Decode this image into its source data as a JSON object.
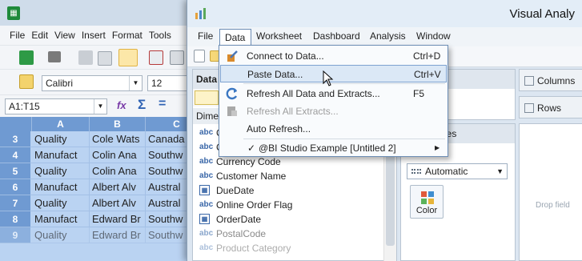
{
  "sheet": {
    "menu": [
      "File",
      "Edit",
      "View",
      "Insert",
      "Format",
      "Tools"
    ],
    "font": "Calibri",
    "font_size": "12",
    "name_box": "A1:T15",
    "columns": [
      "A",
      "B",
      "C"
    ],
    "rows": [
      {
        "num": "3",
        "a": "Quality",
        "b": "Cole Wats",
        "c": "Canada"
      },
      {
        "num": "4",
        "a": "Manufact",
        "b": "Colin Ana",
        "c": "Southw"
      },
      {
        "num": "5",
        "a": "Quality",
        "b": "Colin Ana",
        "c": "Southw"
      },
      {
        "num": "6",
        "a": "Manufact",
        "b": "Albert Alv",
        "c": "Austral"
      },
      {
        "num": "7",
        "a": "Quality",
        "b": "Albert Alv",
        "c": "Austral"
      },
      {
        "num": "8",
        "a": "Manufact",
        "b": "Edward Br",
        "c": "Southw"
      },
      {
        "num": "9",
        "a": "Quality",
        "b": "Edward Br",
        "c": "Southw"
      }
    ]
  },
  "va": {
    "title": "Visual Analy",
    "menu": [
      "File",
      "Data",
      "Worksheet",
      "Dashboard",
      "Analysis",
      "Window"
    ],
    "data_pane_title": "Data",
    "dimensions_label": "Dimens",
    "fields": [
      {
        "icon": "abc",
        "name": "C"
      },
      {
        "icon": "abc",
        "name": "C"
      },
      {
        "icon": "abc",
        "name": "Currency Code"
      },
      {
        "icon": "abc",
        "name": "Customer Name"
      },
      {
        "icon": "date",
        "name": "DueDate"
      },
      {
        "icon": "abc",
        "name": "Online Order Flag"
      },
      {
        "icon": "date",
        "name": "OrderDate"
      },
      {
        "icon": "abc",
        "name": "PostalCode"
      },
      {
        "icon": "abc",
        "name": "Product Category"
      }
    ],
    "properties_label": "erties",
    "mark_type": "Automatic",
    "color_label": "Color",
    "columns_label": "Columns",
    "rows_label": "Rows",
    "drop_hint": "Drop field"
  },
  "data_menu": {
    "items": [
      {
        "label": "Connect to Data...",
        "shortcut": "Ctrl+D",
        "state": "normal"
      },
      {
        "label": "Paste Data...",
        "shortcut": "Ctrl+V",
        "state": "highlighted"
      },
      {
        "label": "Refresh All Data and Extracts...",
        "shortcut": "F5",
        "state": "normal"
      },
      {
        "label": "Refresh All Extracts...",
        "shortcut": "",
        "state": "disabled"
      },
      {
        "label": "Auto Refresh...",
        "shortcut": "",
        "state": "normal"
      },
      {
        "label": "@BI Studio Example [Untitled 2]",
        "shortcut": "",
        "state": "checked-submenu"
      }
    ],
    "check_glyph": "✓",
    "submenu_glyph": "▶"
  },
  "colors": {
    "highlight": "#dbe8f6",
    "selection": "#bad3f2",
    "header_blue": "#6f9ad2"
  }
}
